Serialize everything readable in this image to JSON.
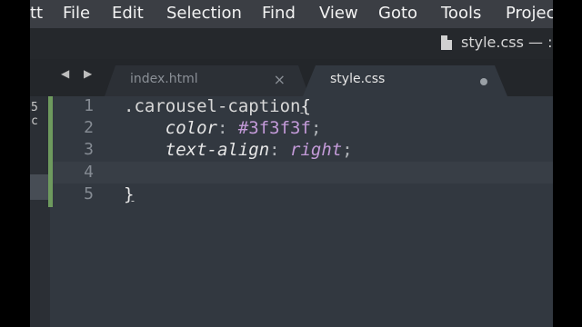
{
  "menubar": {
    "items": [
      "tt",
      "File",
      "Edit",
      "Selection",
      "Find",
      "View",
      "Goto",
      "Tools",
      "Projec"
    ]
  },
  "titlebar": {
    "title": "style.css — :"
  },
  "nav": {
    "arrows": "◀ ▶"
  },
  "tabs": [
    {
      "label": "index.html",
      "control": "×",
      "active": false
    },
    {
      "label": "style.css",
      "active": true,
      "dirty": true
    }
  ],
  "minimap": {
    "text": "5 c"
  },
  "editor": {
    "line_numbers": [
      "1",
      "2",
      "3",
      "4",
      "5"
    ],
    "lines": {
      "l1_selector": ".carousel-caption",
      "l1_brace": "{",
      "l2_indent": "    ",
      "l2_prop": "color",
      "l2_colon": ": ",
      "l2_val": "#3f3f3f",
      "l2_semi": ";",
      "l3_indent": "    ",
      "l3_prop": "text-align",
      "l3_colon": ": ",
      "l3_val": "right",
      "l3_semi": ";",
      "l5_brace": "}"
    }
  },
  "colors": {
    "menubar_bg": "#3b3e44",
    "editor_bg": "#323840",
    "value_purple": "#c39ad8",
    "modified_bar_green": "#6e9a5e"
  }
}
